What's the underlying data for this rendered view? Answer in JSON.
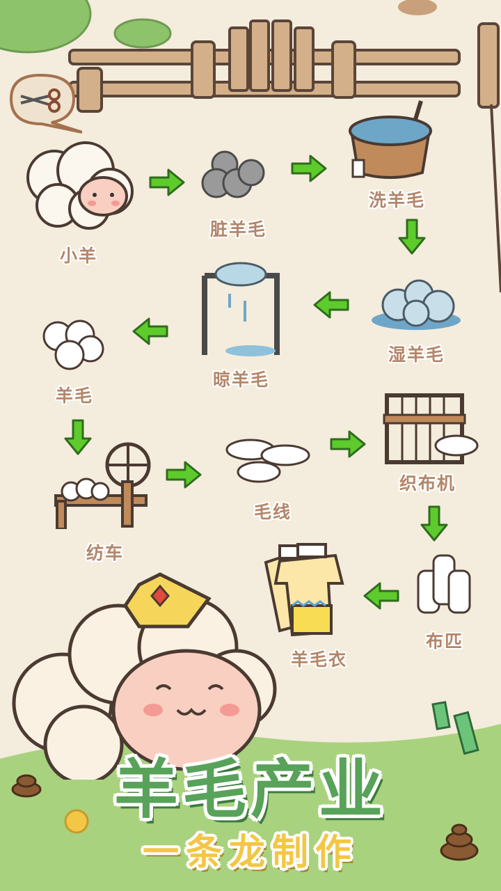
{
  "steps": {
    "lamb": "小羊",
    "dirty_wool": "脏羊毛",
    "wash_wool": "洗羊毛",
    "wet_wool": "湿羊毛",
    "dry_wool": "晾羊毛",
    "wool": "羊毛",
    "spinning_wheel": "纺车",
    "yarn": "毛线",
    "loom": "织布机",
    "cloth": "布匹",
    "sweater": "羊毛衣"
  },
  "headline": {
    "title": "羊毛产业",
    "subtitle": "一条龙制作"
  },
  "colors": {
    "arrow": "#5ecb2c",
    "label": "#b3866a",
    "title": "#58a25a",
    "subtitle": "#f3c646",
    "background": "#f4ecdc",
    "grass": "#a9d27e"
  },
  "icons": [
    "scissors-icon"
  ]
}
